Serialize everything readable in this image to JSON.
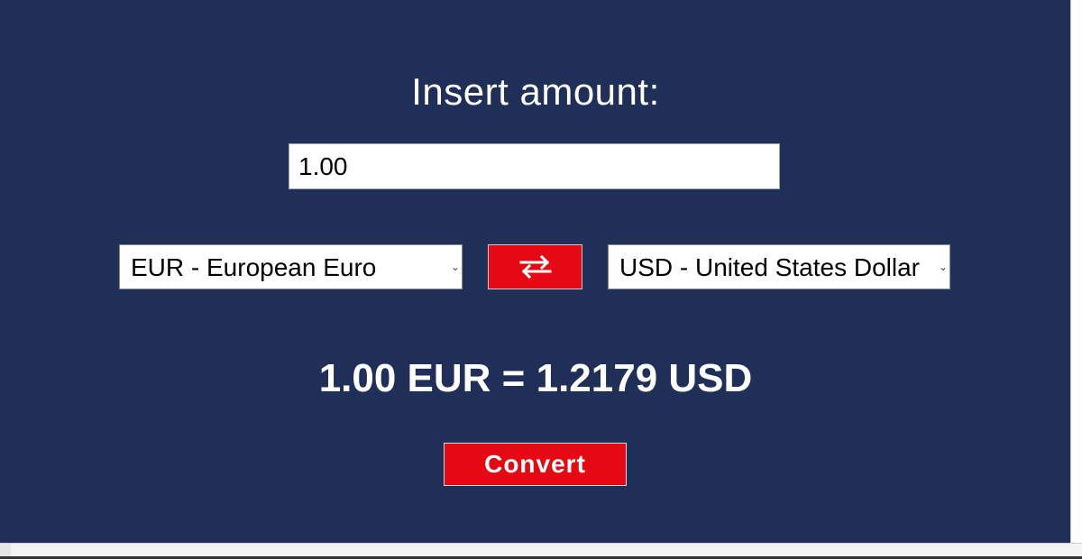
{
  "title": "Insert amount:",
  "amount": {
    "value": "1.00"
  },
  "from_currency": {
    "selected": "EUR - European Euro",
    "chevron_icon": "chevron-down-icon"
  },
  "to_currency": {
    "selected": "USD - United States Dollar",
    "chevron_icon": "chevron-down-icon"
  },
  "swap_button": {
    "icon": "swap-arrows-icon"
  },
  "result_text": "1.00 EUR = 1.2179 USD",
  "convert_label": "Convert",
  "colors": {
    "background": "#202f58",
    "accent_red": "#e50914",
    "text": "#ffffff"
  }
}
